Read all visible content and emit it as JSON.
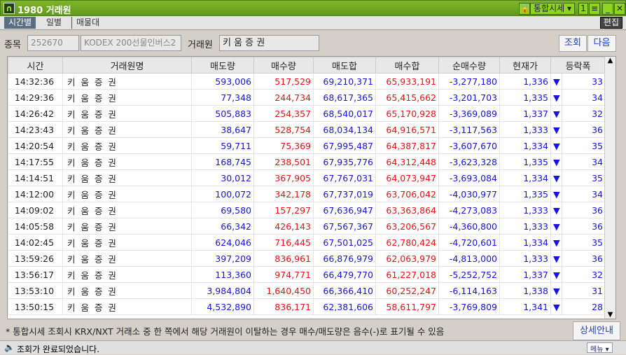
{
  "window": {
    "logo": "∩",
    "title": "1980 거래원",
    "market_select": "통합시세",
    "screen_num": "1"
  },
  "tabs": [
    "시간별",
    "일별",
    "매물대"
  ],
  "edit_label": "편집",
  "form": {
    "code_label": "종목",
    "code": "252670",
    "name": "KODEX 200선물인버스2",
    "broker_label": "거래원",
    "broker": "키 움  증 권",
    "query": "조회",
    "next": "다음"
  },
  "columns": [
    "시간",
    "거래원명",
    "매도량",
    "매수량",
    "매도합",
    "매수합",
    "순매수량",
    "현재가",
    "등락폭"
  ],
  "rows": [
    [
      "14:32:36",
      "키 움  증 권",
      "593,006",
      "517,529",
      "69,210,371",
      "65,933,191",
      "-3,277,180",
      "1,336",
      "33"
    ],
    [
      "14:29:36",
      "키 움  증 권",
      "77,348",
      "244,734",
      "68,617,365",
      "65,415,662",
      "-3,201,703",
      "1,335",
      "34"
    ],
    [
      "14:26:42",
      "키 움  증 권",
      "505,883",
      "254,357",
      "68,540,017",
      "65,170,928",
      "-3,369,089",
      "1,337",
      "32"
    ],
    [
      "14:23:43",
      "키 움  증 권",
      "38,647",
      "528,754",
      "68,034,134",
      "64,916,571",
      "-3,117,563",
      "1,333",
      "36"
    ],
    [
      "14:20:54",
      "키 움  증 권",
      "59,711",
      "75,369",
      "67,995,487",
      "64,387,817",
      "-3,607,670",
      "1,334",
      "35"
    ],
    [
      "14:17:55",
      "키 움  증 권",
      "168,745",
      "238,501",
      "67,935,776",
      "64,312,448",
      "-3,623,328",
      "1,335",
      "34"
    ],
    [
      "14:14:51",
      "키 움  증 권",
      "30,012",
      "367,905",
      "67,767,031",
      "64,073,947",
      "-3,693,084",
      "1,334",
      "35"
    ],
    [
      "14:12:00",
      "키 움  증 권",
      "100,072",
      "342,178",
      "67,737,019",
      "63,706,042",
      "-4,030,977",
      "1,335",
      "34"
    ],
    [
      "14:09:02",
      "키 움  증 권",
      "69,580",
      "157,297",
      "67,636,947",
      "63,363,864",
      "-4,273,083",
      "1,333",
      "36"
    ],
    [
      "14:05:58",
      "키 움  증 권",
      "66,342",
      "426,143",
      "67,567,367",
      "63,206,567",
      "-4,360,800",
      "1,333",
      "36"
    ],
    [
      "14:02:45",
      "키 움  증 권",
      "624,046",
      "716,445",
      "67,501,025",
      "62,780,424",
      "-4,720,601",
      "1,334",
      "35"
    ],
    [
      "13:59:26",
      "키 움  증 권",
      "397,209",
      "836,961",
      "66,876,979",
      "62,063,979",
      "-4,813,000",
      "1,333",
      "36"
    ],
    [
      "13:56:17",
      "키 움  증 권",
      "113,360",
      "974,771",
      "66,479,770",
      "61,227,018",
      "-5,252,752",
      "1,337",
      "32"
    ],
    [
      "13:53:10",
      "키 움  증 권",
      "3,984,804",
      "1,640,450",
      "66,366,410",
      "60,252,247",
      "-6,114,163",
      "1,338",
      "31"
    ],
    [
      "13:50:15",
      "키 움  증 권",
      "4,532,890",
      "836,171",
      "62,381,606",
      "58,611,797",
      "-3,769,809",
      "1,341",
      "28"
    ]
  ],
  "note": "* 통합시세 조회시 KRX/NXT 거래소 중 한 쪽에서 해당 거래원이 이탈하는 경우 매수/매도량은 음수(-)로 표기될 수 있음",
  "detail_button": "상세안내",
  "status": "조회가 완료되었습니다.",
  "menu_button": "메뉴",
  "colors": {
    "sell": "#1414e0",
    "buy": "#f01010",
    "title_green": "#6aa820"
  }
}
